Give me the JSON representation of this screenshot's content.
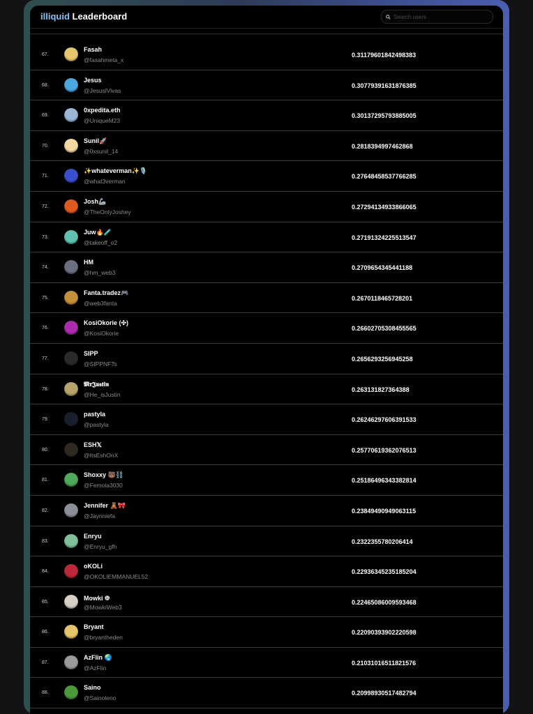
{
  "header": {
    "brand_accent": "illiquid",
    "brand_rest": " Leaderboard",
    "search_placeholder": "Search users"
  },
  "colors": {
    "accent": "#7fc4ff"
  },
  "rows": [
    {
      "rank": "67.",
      "name": "Fasah",
      "handle": "@fasahmeta_x",
      "score": "0.31179601842498383",
      "avatar": "#e8c66a"
    },
    {
      "rank": "68.",
      "name": "Jesus",
      "handle": "@JesuslVivas",
      "score": "0.30779391631876385",
      "avatar": "#4aa8e0"
    },
    {
      "rank": "69.",
      "name": "0xpedita.eth",
      "handle": "@UniqueM23",
      "score": "0.30137295793885005",
      "avatar": "#9ab6d6"
    },
    {
      "rank": "70.",
      "name": "Sunil🚀",
      "handle": "@0xsunil_14",
      "score": "0.2818394997462868",
      "avatar": "#f3d9a0"
    },
    {
      "rank": "71.",
      "name": "✨whateverman✨🎙️",
      "handle": "@what3verman",
      "score": "0.27648458537766285",
      "avatar": "#3a4fd0"
    },
    {
      "rank": "72.",
      "name": "Josh🦾",
      "handle": "@TheOnlyJoshey",
      "score": "0.27294134933866065",
      "avatar": "#e05a1e"
    },
    {
      "rank": "73.",
      "name": "Juw🔥🧪",
      "handle": "@takeoff_o2",
      "score": "0.27191324225513547",
      "avatar": "#5fc2b0"
    },
    {
      "rank": "74.",
      "name": "HM",
      "handle": "@hm_web3",
      "score": "0.2709654345441188",
      "avatar": "#6a7080"
    },
    {
      "rank": "75.",
      "name": "Fanta.tradez🎮",
      "handle": "@web3fanta",
      "score": "0.2670118465728201",
      "avatar": "#c4913a"
    },
    {
      "rank": "76.",
      "name": "KosiOkorie (✣)",
      "handle": "@KosiOkorie",
      "score": "0.26602705308455565",
      "avatar": "#b02ab0"
    },
    {
      "rank": "77.",
      "name": "SIPP",
      "handle": "@SIPPNFTs",
      "score": "0.2656293256945258",
      "avatar": "#2a2a2a"
    },
    {
      "rank": "78.",
      "name": "𝕸𝖗𝕵𝖚𝖘𝖙𝖎𝖓",
      "handle": "@He_isJustin",
      "score": "0.263131827364388",
      "avatar": "#b8a46a"
    },
    {
      "rank": "79.",
      "name": "pastyla",
      "handle": "@pastyla",
      "score": "0.26246297606391533",
      "avatar": "#1a1f2e"
    },
    {
      "rank": "80.",
      "name": "ESH𝕏",
      "handle": "@ItsEshOnX",
      "score": "0.25770619362076513",
      "avatar": "#2e2a22"
    },
    {
      "rank": "81.",
      "name": "Shoxxy 🐻⛓️",
      "handle": "@Femola3030",
      "score": "0.25186496343382814",
      "avatar": "#4caa5a"
    },
    {
      "rank": "82.",
      "name": "Jennifer 🧸🎀",
      "handle": "@Jaynniefa",
      "score": "0.23849490949063115",
      "avatar": "#8a8f98"
    },
    {
      "rank": "83.",
      "name": "Enryu",
      "handle": "@Enryu_gfh",
      "score": "0.2322355780206414",
      "avatar": "#7fbf9a"
    },
    {
      "rank": "84.",
      "name": "oKOLi",
      "handle": "@OKOLIEMMANUEL52",
      "score": "0.22936345235185204",
      "avatar": "#c0283a"
    },
    {
      "rank": "85.",
      "name": "Mowki 𐃏",
      "handle": "@MowkiWeb3",
      "score": "0.22465086009593468",
      "avatar": "#d8d0c4"
    },
    {
      "rank": "86.",
      "name": "Bryant",
      "handle": "@bryantheden",
      "score": "0.22090393902220598",
      "avatar": "#e6c46a"
    },
    {
      "rank": "87.",
      "name": "AzFlin 🌏",
      "handle": "@AzFlin",
      "score": "0.21031016511821576",
      "avatar": "#9a9a9a"
    },
    {
      "rank": "88.",
      "name": "Saino",
      "handle": "@Sainoleno",
      "score": "0.20998930517482794",
      "avatar": "#4a9a3a"
    }
  ]
}
